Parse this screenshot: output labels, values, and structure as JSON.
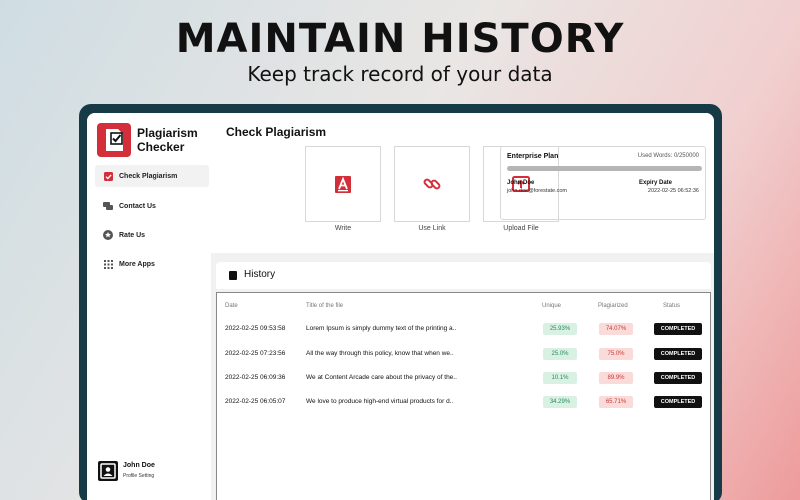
{
  "hero": {
    "title": "MAINTAIN HISTORY",
    "subtitle": "Keep track record of your data"
  },
  "app": {
    "name_line1": "Plagiarism",
    "name_line2": "Checker",
    "brand_color": "#d32f3a"
  },
  "sidebar": {
    "items": [
      {
        "label": "Check Plagiarism",
        "icon": "checkbox-icon",
        "active": true
      },
      {
        "label": "Contact Us",
        "icon": "chat-icon",
        "active": false
      },
      {
        "label": "Rate Us",
        "icon": "star-icon",
        "active": false
      },
      {
        "label": "More Apps",
        "icon": "grid-icon",
        "active": false
      }
    ],
    "profile": {
      "name": "John Doe",
      "sub": "Profile Setting"
    }
  },
  "main": {
    "title": "Check Plagiarism",
    "options": [
      {
        "label": "Write",
        "icon": "write-icon"
      },
      {
        "label": "Use Link",
        "icon": "link-icon"
      },
      {
        "label": "Upload File",
        "icon": "upload-icon"
      }
    ],
    "plan": {
      "name": "Enterprise Plan",
      "used_words": "Used Words: 0/250000",
      "user_name": "John Doe",
      "email": "john.doe@forestate.com",
      "expiry_label": "Expiry Date",
      "expiry_value": "2022-02-25 06:52:36"
    }
  },
  "history": {
    "title": "History",
    "columns": [
      "Date",
      "Title of the file",
      "Unique",
      "Plagiarized",
      "Status"
    ],
    "rows": [
      {
        "date": "2022-02-25 09:53:58",
        "title": "Lorem Ipsum is simply dummy text of the printing a..",
        "unique": "25.93%",
        "plagiarized": "74.07%",
        "status": "COMPLETED"
      },
      {
        "date": "2022-02-25 07:23:56",
        "title": "All the way through this policy, know that when we..",
        "unique": "25.0%",
        "plagiarized": "75.0%",
        "status": "COMPLETED"
      },
      {
        "date": "2022-02-25 06:09:36",
        "title": "We at Content Arcade care about the privacy of the..",
        "unique": "10.1%",
        "plagiarized": "89.9%",
        "status": "COMPLETED"
      },
      {
        "date": "2022-02-25 06:05:07",
        "title": "We love to produce high-end virtual products for d..",
        "unique": "34.29%",
        "plagiarized": "65.71%",
        "status": "COMPLETED"
      }
    ]
  }
}
